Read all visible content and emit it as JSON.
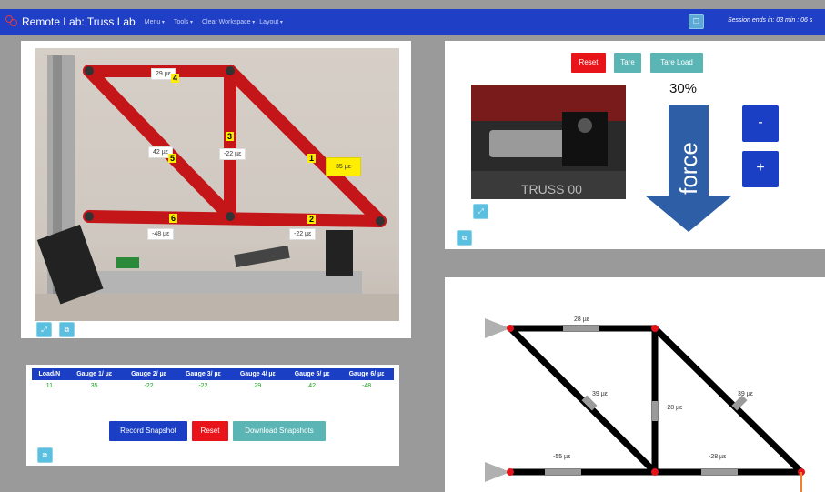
{
  "navbar": {
    "title": "Remote Lab: Truss Lab",
    "menus": [
      "Menu",
      "Tools",
      "Clear Workspace",
      "Layout"
    ],
    "button_label": "☐",
    "session_text": "Session ends in: 03 min : 06 s"
  },
  "camera": {
    "gauge_labels": [
      {
        "num": "1",
        "text": "35 µε",
        "highlight": true
      },
      {
        "num": "2",
        "text": "-22 µε"
      },
      {
        "num": "3",
        "text": "-22 µε"
      },
      {
        "num": "4",
        "text": "29 µε"
      },
      {
        "num": "5",
        "text": "42 µε"
      },
      {
        "num": "6",
        "text": "-48 µε"
      }
    ],
    "buttons": [
      "⤢",
      "⧉"
    ]
  },
  "control": {
    "reset_label": "Reset",
    "tare_label": "Tare",
    "tare_load_label": "Tare Load",
    "force_percent": "30%",
    "force_label": "force",
    "minus_label": "-",
    "plus_label": "+",
    "cam_text": "TRUSS 00",
    "panel_button": "⧉",
    "cam_button": "⤢"
  },
  "table": {
    "headers": [
      "Load/N",
      "Gauge 1/ µε",
      "Gauge 2/ µε",
      "Gauge 3/ µε",
      "Gauge 4/ µε",
      "Gauge 5/ µε",
      "Gauge 6/ µε"
    ],
    "row": [
      "11",
      "35",
      "-22",
      "-22",
      "29",
      "42",
      "-48"
    ],
    "record_label": "Record Snapshot",
    "reset_label": "Reset",
    "download_label": "Download Snapshots",
    "panel_button": "⧉"
  },
  "diagram": {
    "labels": {
      "top": "28 µε",
      "diag_left": "39 µε",
      "vertical": "-28 µε",
      "diag_right": "39 µε",
      "bottom_left": "-55 µε",
      "bottom_right": "-28 µε"
    }
  },
  "colors": {
    "navbar": "#1f3fc6",
    "primary": "#1a3fc4",
    "danger": "#e8141a",
    "teal": "#5bb5b5",
    "gauge_highlight": "#ffee00"
  }
}
